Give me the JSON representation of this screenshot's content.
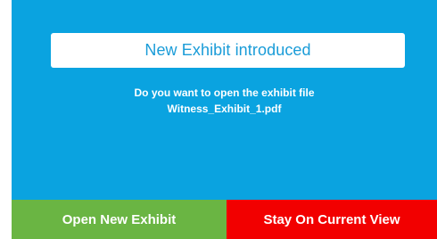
{
  "dialog": {
    "title": "New Exhibit introduced",
    "message_line1": "Do you want to open the exhibit file",
    "message_line2": "Witness_Exhibit_1.pdf",
    "open_button_label": "Open New Exhibit",
    "stay_button_label": "Stay On Current View"
  },
  "colors": {
    "dialog_background": "#0aa3e0",
    "title_text": "#1a9cd8",
    "open_button": "#6ab543",
    "stay_button": "#f20000"
  }
}
